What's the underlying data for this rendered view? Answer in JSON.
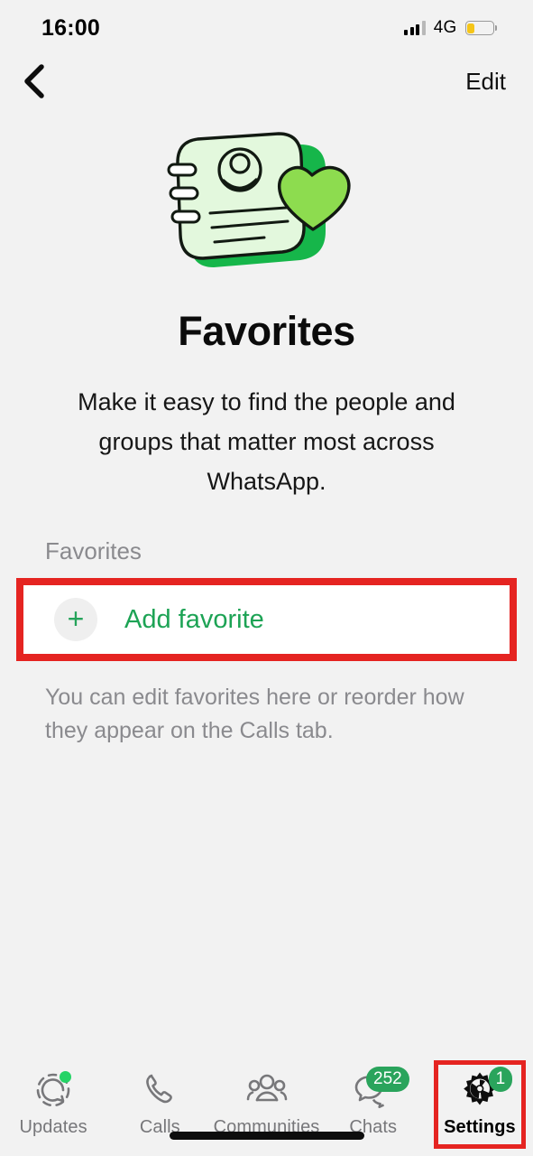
{
  "status_bar": {
    "time": "16:00",
    "network": "4G",
    "signal_icon": "signal-bars-icon",
    "battery_icon": "battery-low-icon",
    "battery_level_percent": 25,
    "battery_color": "#f5c518"
  },
  "nav_bar": {
    "back_icon": "chevron-left-icon",
    "edit_label": "Edit"
  },
  "hero": {
    "illustration_name": "favorites-contact-card-heart-illustration",
    "title": "Favorites",
    "description": "Make it easy to find the people and groups that matter most across WhatsApp."
  },
  "favorites_section": {
    "header": "Favorites",
    "add_favorite": {
      "label": "Add favorite",
      "icon": "plus-icon",
      "highlighted": true,
      "highlight_color": "#e52421"
    },
    "footnote": "You can edit favorites here or reorder how they appear on the Calls tab."
  },
  "tab_bar": {
    "tabs": [
      {
        "label": "Updates",
        "icon": "updates-status-icon",
        "badge": "",
        "badge_type": "dot",
        "active": false
      },
      {
        "label": "Calls",
        "icon": "phone-icon",
        "badge": "",
        "badge_type": "none",
        "active": false
      },
      {
        "label": "Communities",
        "icon": "communities-people-icon",
        "badge": "",
        "badge_type": "none",
        "active": false
      },
      {
        "label": "Chats",
        "icon": "chat-bubbles-icon",
        "badge": "252",
        "badge_type": "pill",
        "active": false
      },
      {
        "label": "Settings",
        "icon": "gear-icon",
        "badge": "1",
        "badge_type": "pill",
        "active": true
      }
    ],
    "home_indicator": "home-indicator-bar"
  },
  "colors": {
    "background": "#f2f2f2",
    "card": "#ffffff",
    "accent_green": "#1da355",
    "badge_green": "#2aa45c",
    "highlight_red": "#e52421",
    "muted_text": "#8a8a8e"
  }
}
